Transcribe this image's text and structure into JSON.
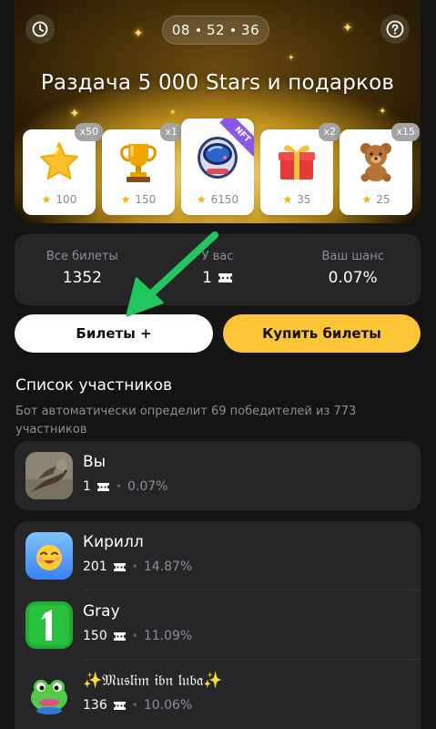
{
  "header": {
    "timer": {
      "h": "08",
      "m": "52",
      "s": "36"
    },
    "title": "Раздача 5 000 Stars и подарков"
  },
  "prizes": [
    {
      "name": "star",
      "qty": "x50",
      "price": "100"
    },
    {
      "name": "trophy",
      "qty": "x1",
      "price": "150"
    },
    {
      "name": "nft-helmet",
      "badge": "NFT",
      "price": "6150"
    },
    {
      "name": "gift-box",
      "qty": "x2",
      "price": "35"
    },
    {
      "name": "teddy-bear",
      "qty": "x15",
      "price": "25"
    }
  ],
  "stats": {
    "all_label": "Все билеты",
    "all_value": "1352",
    "you_label": "У вас",
    "you_value": "1",
    "chance_label": "Ваш шанс",
    "chance_value": "0.07%"
  },
  "actions": {
    "tickets_label": "Билеты +",
    "buy_label": "Купить билеты"
  },
  "participants": {
    "title": "Список участников",
    "description": "Бот автоматически определит 69 победителей из 773 участников",
    "me": {
      "name": "Вы",
      "tickets": "1",
      "chance": "0.07%"
    },
    "list": [
      {
        "name": "Кирилл",
        "tickets": "201",
        "chance": "14.87%"
      },
      {
        "name": "Gray",
        "tickets": "150",
        "chance": "11.09%"
      },
      {
        "name": "✨𝔐𝔲𝔰𝔩𝔦𝔪 𝔦𝔟𝔫 𝔩𝔲𝔟𝔞✨",
        "tickets": "136",
        "chance": "10.06%"
      }
    ]
  },
  "colors": {
    "background": "#141414",
    "card": "#262629",
    "accent_yellow": "#fbc537",
    "muted_text": "#8e8e93",
    "arrow_green": "#22c55e"
  }
}
